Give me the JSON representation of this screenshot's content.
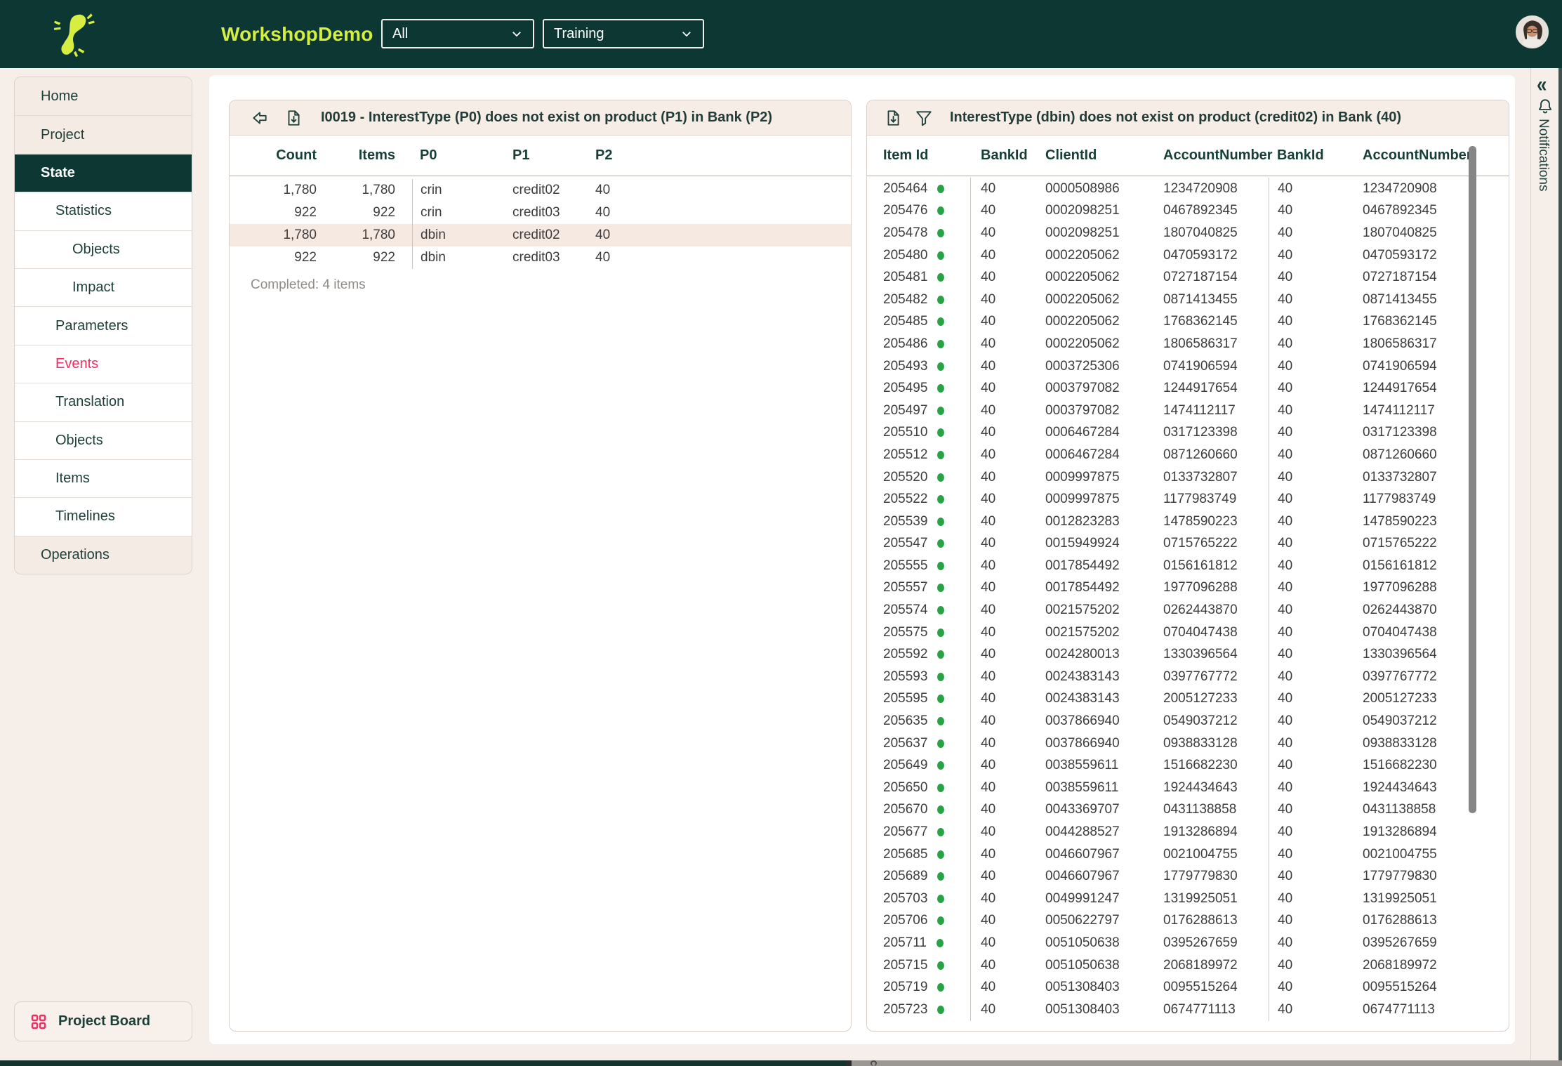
{
  "header": {
    "app_title": "WorkshopDemo",
    "scope_select_value": "All",
    "mode_select_value": "Training"
  },
  "sidebar": {
    "items": [
      {
        "label": "Home",
        "level": 0,
        "selected": false,
        "accent": false
      },
      {
        "label": "Project",
        "level": 0,
        "selected": false,
        "accent": false
      },
      {
        "label": "State",
        "level": 0,
        "selected": true,
        "accent": false
      },
      {
        "label": "Statistics",
        "level": 1,
        "selected": false,
        "accent": false
      },
      {
        "label": "Objects",
        "level": 2,
        "selected": false,
        "accent": false
      },
      {
        "label": "Impact",
        "level": 2,
        "selected": false,
        "accent": false
      },
      {
        "label": "Parameters",
        "level": 1,
        "selected": false,
        "accent": false
      },
      {
        "label": "Events",
        "level": 1,
        "selected": false,
        "accent": true
      },
      {
        "label": "Translation",
        "level": 1,
        "selected": false,
        "accent": false
      },
      {
        "label": "Objects",
        "level": 1,
        "selected": false,
        "accent": false
      },
      {
        "label": "Items",
        "level": 1,
        "selected": false,
        "accent": false
      },
      {
        "label": "Timelines",
        "level": 1,
        "selected": false,
        "accent": false
      },
      {
        "label": "Operations",
        "level": 0,
        "selected": false,
        "accent": false
      }
    ],
    "project_board_label": "Project Board"
  },
  "left_panel": {
    "title": "I0019 - InterestType (P0) does not exist on product (P1) in Bank (P2)",
    "columns": [
      "Count",
      "Items",
      "P0",
      "P1",
      "P2"
    ],
    "rows": [
      [
        "1,780",
        "1,780",
        "crin",
        "credit02",
        "40"
      ],
      [
        "922",
        "922",
        "crin",
        "credit03",
        "40"
      ],
      [
        "1,780",
        "1,780",
        "dbin",
        "credit02",
        "40"
      ],
      [
        "922",
        "922",
        "dbin",
        "credit03",
        "40"
      ]
    ],
    "highlighted_row_index": 2,
    "footer": "Completed: 4 items"
  },
  "right_panel": {
    "title": "InterestType (dbin) does not exist on product (credit02) in Bank (40)",
    "columns": [
      "Item Id",
      "BankId",
      "ClientId",
      "AccountNumber",
      "BankId",
      "AccountNumber"
    ],
    "rows": [
      [
        "205464",
        "40",
        "0000508986",
        "1234720908",
        "40",
        "1234720908"
      ],
      [
        "205476",
        "40",
        "0002098251",
        "0467892345",
        "40",
        "0467892345"
      ],
      [
        "205478",
        "40",
        "0002098251",
        "1807040825",
        "40",
        "1807040825"
      ],
      [
        "205480",
        "40",
        "0002205062",
        "0470593172",
        "40",
        "0470593172"
      ],
      [
        "205481",
        "40",
        "0002205062",
        "0727187154",
        "40",
        "0727187154"
      ],
      [
        "205482",
        "40",
        "0002205062",
        "0871413455",
        "40",
        "0871413455"
      ],
      [
        "205485",
        "40",
        "0002205062",
        "1768362145",
        "40",
        "1768362145"
      ],
      [
        "205486",
        "40",
        "0002205062",
        "1806586317",
        "40",
        "1806586317"
      ],
      [
        "205493",
        "40",
        "0003725306",
        "0741906594",
        "40",
        "0741906594"
      ],
      [
        "205495",
        "40",
        "0003797082",
        "1244917654",
        "40",
        "1244917654"
      ],
      [
        "205497",
        "40",
        "0003797082",
        "1474112117",
        "40",
        "1474112117"
      ],
      [
        "205510",
        "40",
        "0006467284",
        "0317123398",
        "40",
        "0317123398"
      ],
      [
        "205512",
        "40",
        "0006467284",
        "0871260660",
        "40",
        "0871260660"
      ],
      [
        "205520",
        "40",
        "0009997875",
        "0133732807",
        "40",
        "0133732807"
      ],
      [
        "205522",
        "40",
        "0009997875",
        "1177983749",
        "40",
        "1177983749"
      ],
      [
        "205539",
        "40",
        "0012823283",
        "1478590223",
        "40",
        "1478590223"
      ],
      [
        "205547",
        "40",
        "0015949924",
        "0715765222",
        "40",
        "0715765222"
      ],
      [
        "205555",
        "40",
        "0017854492",
        "0156161812",
        "40",
        "0156161812"
      ],
      [
        "205557",
        "40",
        "0017854492",
        "1977096288",
        "40",
        "1977096288"
      ],
      [
        "205574",
        "40",
        "0021575202",
        "0262443870",
        "40",
        "0262443870"
      ],
      [
        "205575",
        "40",
        "0021575202",
        "0704047438",
        "40",
        "0704047438"
      ],
      [
        "205592",
        "40",
        "0024280013",
        "1330396564",
        "40",
        "1330396564"
      ],
      [
        "205593",
        "40",
        "0024383143",
        "0397767772",
        "40",
        "0397767772"
      ],
      [
        "205595",
        "40",
        "0024383143",
        "2005127233",
        "40",
        "2005127233"
      ],
      [
        "205635",
        "40",
        "0037866940",
        "0549037212",
        "40",
        "0549037212"
      ],
      [
        "205637",
        "40",
        "0037866940",
        "0938833128",
        "40",
        "0938833128"
      ],
      [
        "205649",
        "40",
        "0038559611",
        "1516682230",
        "40",
        "1516682230"
      ],
      [
        "205650",
        "40",
        "0038559611",
        "1924434643",
        "40",
        "1924434643"
      ],
      [
        "205670",
        "40",
        "0043369707",
        "0431138858",
        "40",
        "0431138858"
      ],
      [
        "205677",
        "40",
        "0044288527",
        "1913286894",
        "40",
        "1913286894"
      ],
      [
        "205685",
        "40",
        "0046607967",
        "0021004755",
        "40",
        "0021004755"
      ],
      [
        "205689",
        "40",
        "0046607967",
        "1779779830",
        "40",
        "1779779830"
      ],
      [
        "205703",
        "40",
        "0049991247",
        "1319925051",
        "40",
        "1319925051"
      ],
      [
        "205706",
        "40",
        "0050622797",
        "0176288613",
        "40",
        "0176288613"
      ],
      [
        "205711",
        "40",
        "0051050638",
        "0395267659",
        "40",
        "0395267659"
      ],
      [
        "205715",
        "40",
        "0051050638",
        "2068189972",
        "40",
        "2068189972"
      ],
      [
        "205719",
        "40",
        "0051308403",
        "0095515264",
        "40",
        "0095515264"
      ],
      [
        "205723",
        "40",
        "0051308403",
        "0674771113",
        "40",
        "0674771113"
      ]
    ],
    "status_dot": "green"
  },
  "notifications_rail": {
    "label": "Notifications",
    "collapse_glyph": "«"
  },
  "icons": [
    "gecko-logo-icon",
    "chevron-down-icon",
    "back-arrow-icon",
    "download-file-icon",
    "filter-funnel-icon",
    "bell-icon",
    "grid-board-icon",
    "status-dot-icon"
  ],
  "colors": {
    "brand-teal": "#0d3733",
    "brand-lime": "#d6ee40",
    "page-cream": "#f6eee8",
    "panel-cream": "#f7ede7",
    "accent-pink": "#ef2e63",
    "status-green": "#27a344",
    "highlight-row": "#f6e9e2"
  }
}
